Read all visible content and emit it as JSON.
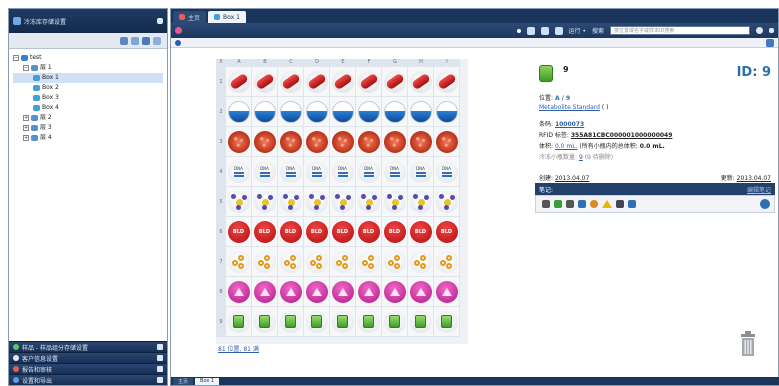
{
  "left_panel": {
    "title": "冷冻库存储设置",
    "tree": [
      {
        "label": "test",
        "level": 0,
        "sign": "−"
      },
      {
        "label": "层 1",
        "level": 1,
        "sign": "−"
      },
      {
        "label": "Box 1",
        "level": 2,
        "selected": true
      },
      {
        "label": "Box 2",
        "level": 2
      },
      {
        "label": "Box 3",
        "level": 2
      },
      {
        "label": "Box 4",
        "level": 2
      },
      {
        "label": "层 2",
        "level": 1,
        "sign": "+"
      },
      {
        "label": "层 3",
        "level": 1,
        "sign": "+"
      },
      {
        "label": "层 4",
        "level": 1,
        "sign": "+"
      }
    ],
    "accordion": [
      "样品 - 样品组分存储设置",
      "客户信息设置",
      "报告和审核",
      "设置和导出"
    ]
  },
  "tabs": [
    {
      "label": "主页",
      "active": false
    },
    {
      "label": "Box 1",
      "active": true
    }
  ],
  "toolbar": {
    "run_label": "运行 •",
    "search_label": "搜索",
    "search_placeholder": "按位置或名字或样本ID搜索"
  },
  "grid": {
    "columns": [
      "A",
      "B",
      "C",
      "D",
      "E",
      "F",
      "G",
      "H",
      "I"
    ],
    "rows": [
      "1",
      "2",
      "3",
      "4",
      "5",
      "6",
      "7",
      "8",
      "9"
    ],
    "row_types": [
      "red-pill",
      "water",
      "cells",
      "dna",
      "molecule",
      "bld",
      "chain",
      "pink",
      "green-vial"
    ],
    "footer": "81 位置, 81 满"
  },
  "details": {
    "count": "9",
    "id_label": "ID: 9",
    "position_label": "位置:",
    "position_value": "A / 9",
    "name": "Metabolite Standard",
    "name_suffix": "( )",
    "barcode_label": "条码:",
    "barcode_value": "1000073",
    "rfid_label": "RFID 标签:",
    "rfid_value": "355A81CBC000001000000049",
    "volume_label": "体积:",
    "volume_value": "0.0 mL.",
    "volume_note": "(所有小瓶内的总体积:",
    "volume_total": "0.0 mL.",
    "vials_label": "冷冻小瓶数量:",
    "vials_value": "9",
    "vials_note": "(9 待删除)",
    "created_label": "创建:",
    "created_value": "2013.04.07",
    "modified_label": "更新:",
    "modified_value": "2013.04.07",
    "notes_label": "笔记:",
    "notes_edit": "编辑笔记"
  },
  "bottom_tabs": [
    "主页",
    "Box 1"
  ],
  "colors": {
    "header": "#1a355c",
    "accent": "#2d6ea8",
    "selection": "#cfe0f7"
  }
}
